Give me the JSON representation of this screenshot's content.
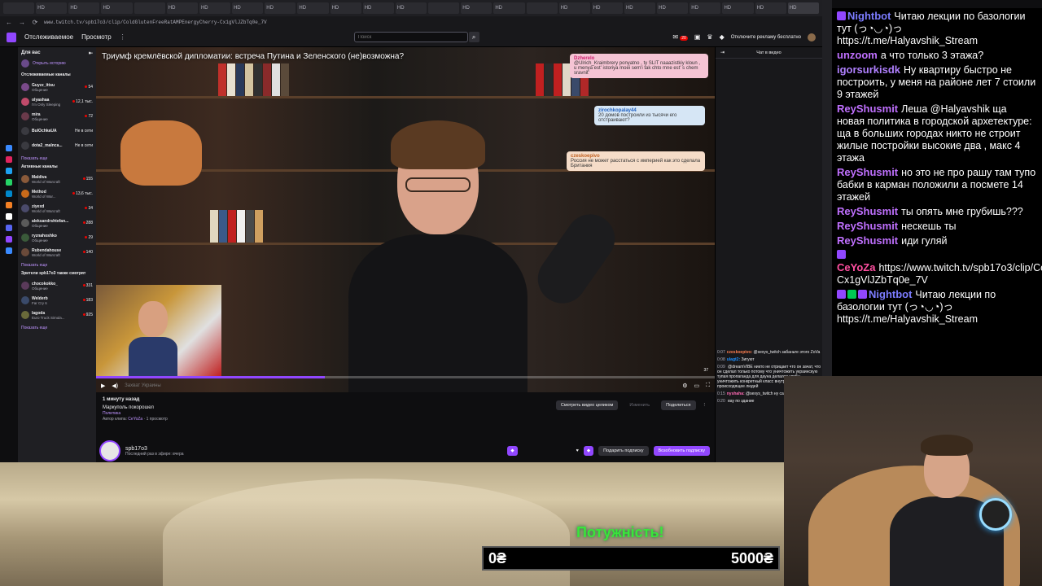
{
  "browser": {
    "tabs": [
      "",
      "HD",
      "HD",
      "HD",
      "",
      "HD",
      "HD",
      "HD",
      "HD",
      "HD",
      "HD",
      "HD",
      "HD",
      "",
      "HD",
      "HD",
      "",
      "HD",
      "HD",
      "HD",
      "HD",
      "HD",
      "HD",
      "HD",
      "HD"
    ],
    "url": "www.twitch.tv/spb17o3/clip/ColdGlutenFreeRatAMPEnergyCherry-Cx1gVlJZbTq0e_7V"
  },
  "topnav": {
    "following": "Отслеживаемое",
    "browse": "Просмотр",
    "search_placeholder": "Поиск",
    "notif_count": "20",
    "prime_label": "Отключите рекламу бесплатно"
  },
  "sidebar": {
    "for_you": "Для вас",
    "history": "Открыть историю",
    "followed_header": "Отслеживаемые каналы",
    "followed": [
      {
        "name": "Guyzz_ittsu",
        "game": "Общение",
        "viewers": "54",
        "color": "#7a4a8a"
      },
      {
        "name": "olyashaa",
        "game": "I'm Only Sleeping",
        "viewers": "12,1 тыс.",
        "color": "#c04a6a"
      },
      {
        "name": "mira",
        "game": "Общение",
        "viewers": "72",
        "color": "#6a3a4a"
      },
      {
        "name": "BulOchkaUA",
        "game": "",
        "viewers": "Не в сети",
        "color": "#3a3a40"
      },
      {
        "name": "dota2_malnca...",
        "game": "",
        "viewers": "Не в сети",
        "color": "#3a3a40"
      }
    ],
    "show_more_1": "Показать еще",
    "active_header": "Активные каналы",
    "active": [
      {
        "name": "Maldiva",
        "game": "World of Warcraft",
        "viewers": "155",
        "color": "#8a5a3a"
      },
      {
        "name": "Method",
        "game": "World of War...",
        "viewers": "13,6 тыс.",
        "color": "#c86a1a"
      },
      {
        "name": "ziyexd",
        "game": "World of Warcraft",
        "viewers": "34",
        "color": "#4a4a6a"
      },
      {
        "name": "aleksandrshtefan...",
        "game": "Общение",
        "viewers": "288",
        "color": "#5a5a5a"
      },
      {
        "name": "ryznahoshko",
        "game": "Общение",
        "viewers": "29",
        "color": "#3a5a3a"
      },
      {
        "name": "Rubendahouse",
        "game": "World of Warcraft",
        "viewers": "140",
        "color": "#6a4a3a"
      }
    ],
    "show_more_2": "Показать еще",
    "also_watch_header": "Зрители spb17o3 также смотрят",
    "also": [
      {
        "name": "chocokokko_",
        "game": "Общение",
        "viewers": "331",
        "color": "#5a3a5a"
      },
      {
        "name": "Welderb",
        "game": "Far Cry 6",
        "viewers": "183",
        "color": "#3a4a6a"
      },
      {
        "name": "lagoda",
        "game": "Euro Truck Simula...",
        "viewers": "925",
        "color": "#6a6a3a"
      }
    ],
    "show_more_3": "Показать еще"
  },
  "video": {
    "title": "Триумф кремлёвской дипломатии: встреча Путина и Зеленского (не)возможна?",
    "overlay_chat": [
      {
        "name": "Dzherelo",
        "msg": "@Ulrich_Kraimbrery ponyatno , ty SLIT naaazistkiy kloun , u menya est' istoriya moei sem'i tak chto mne est' s chem sravnit'",
        "bg": "#f5c4d4",
        "name_color": "#d02070"
      },
      {
        "name": "zirochkopalay44",
        "msg": "20 домов построили из тысячи его отстраивают?",
        "bg": "#d6e6f5",
        "name_color": "#2060c0"
      },
      {
        "name": "czeskoepivo",
        "msg": "Россия не может расстаться с империей как это сделала Британия",
        "bg": "#f5dcc8",
        "name_color": "#c06020"
      }
    ],
    "progress": 0.37,
    "time_right": "37",
    "hidden_caption": "Захват Украины"
  },
  "clip": {
    "time_ago": "1 минуту назад",
    "title": "Маркуполь покорошел",
    "category": "Политика",
    "author_prefix": "Автор клипа:",
    "author": "CeYoZa",
    "views": "1 просмотр",
    "watch_full": "Смотреть видео целиком",
    "edit": "Изменить",
    "share": "Поделиться"
  },
  "channel": {
    "name": "spb17o3",
    "last_live": "Последний раз в эфире: вчера",
    "gift": "Подарить подписку",
    "resub": "Возобновить подписку"
  },
  "twitch_chat": {
    "header": "Чат в видео",
    "lines": [
      {
        "ts": "0:07",
        "user": "czeskoepivo:",
        "msg": "@sexys_twitch забаньте этого ZoVa",
        "color": "#ff7f50"
      },
      {
        "ts": "0:08",
        "user": "ulagt2:",
        "msg": "Зигуют",
        "color": "#1e90ff"
      },
      {
        "ts": "0:09",
        "user": "",
        "msg": "@dreamVIBE никто не отрицает что он зачат, что он сделал только потому что уничтожить украинскую тупая пропаганда для дауна делался чтобы уничтожить конкретный класс внутри было похуй на происходящее людей",
        "color": "#9acd32"
      },
      {
        "ts": "0:15",
        "user": "nyshaha:",
        "msg": "@sexys_twitch ну сам шпион",
        "color": "#ff69b4"
      },
      {
        "ts": "0:20",
        "user": "",
        "msg": "вау по здание",
        "color": "#daa520"
      }
    ]
  },
  "stream_chat": [
    {
      "user": "Nightbot",
      "msg": "Читаю лекции по базологии тут (っ◔◡◔)っ https://t.me/Halyavshik_Stream",
      "color": "#7c7cff",
      "badges": [
        "#9147ff"
      ]
    },
    {
      "user": "unzoom",
      "msg": "а что только 3 этажа?",
      "color": "#c070ff",
      "badges": []
    },
    {
      "user": "igorsurkisdk",
      "msg": "Ну квартиру быстро не построить, у меня на районе лет 7 стоили 9 этажей",
      "color": "#b080ff",
      "badges": []
    },
    {
      "user": "ReyShusmit",
      "msg": "Леша @Halyavshik ща новая политика в городской архетектуре: ща в больших городах никто не строит жилые постройки высокие два , макс 4 этажа",
      "color": "#c070ff",
      "badges": []
    },
    {
      "user": "ReyShusmit",
      "msg": "но это не про рашу там тупо бабки в карман положили а посмете 14 этажей",
      "color": "#c070ff",
      "badges": []
    },
    {
      "user": "ReyShusmit",
      "msg": "ты опять мне грубишь???",
      "color": "#c070ff",
      "badges": []
    },
    {
      "user": "ReyShusmit",
      "msg": "нескешь ты",
      "color": "#c070ff",
      "badges": []
    },
    {
      "user": "ReyShusmit",
      "msg": "иди гуляй",
      "color": "#c070ff",
      "badges": []
    },
    {
      "user": "CeYoZa",
      "msg": "https://www.twitch.tv/spb17o3/clip/ColdGlutenFreeRatAMPEnergyCherry-Cx1gVlJZbTq0e_7V",
      "color": "#ff4fa0",
      "badges": [
        "#9147ff"
      ]
    },
    {
      "user": "Nightbot",
      "msg": "Читаю лекции по базологии тут (っ◔◡◔)っ https://t.me/Halyavshik_Stream",
      "color": "#7c7cff",
      "badges": [
        "#9147ff",
        "#00c853",
        "#9147ff"
      ]
    }
  ],
  "alert": {
    "label": "Потужність!",
    "min": "0₴",
    "max": "5000₴",
    "fill": 0
  }
}
